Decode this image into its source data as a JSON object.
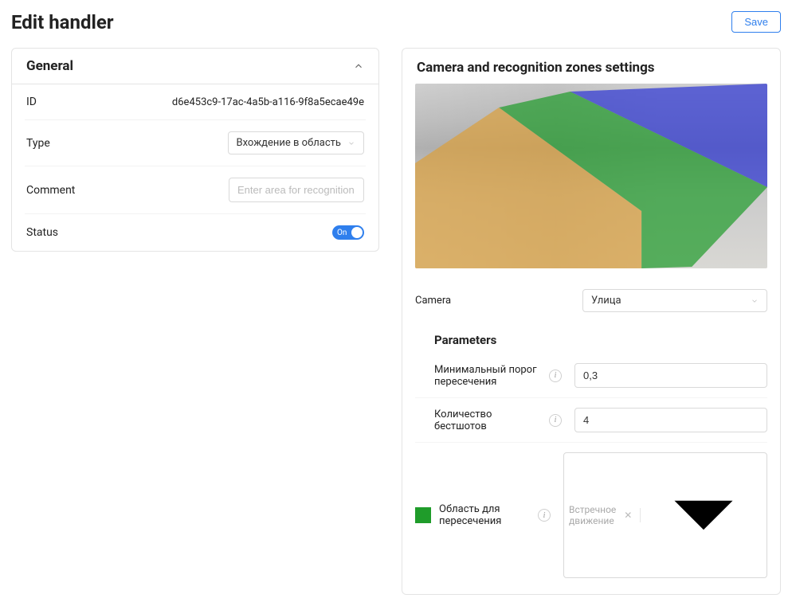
{
  "page_title": "Edit handler",
  "save_label": "Save",
  "general": {
    "title": "General",
    "id_label": "ID",
    "id_value": "d6e453c9-17ac-4a5b-a116-9f8a5ecae49e",
    "type_label": "Type",
    "type_value": "Вхождение в область",
    "comment_label": "Comment",
    "comment_placeholder": "Enter area for recognition",
    "status_label": "Status",
    "status_on": "On"
  },
  "right_panel": {
    "title": "Camera and recognition zones settings",
    "camera_label": "Camera",
    "camera_value": "Улица",
    "parameters_title": "Parameters",
    "zones": [
      {
        "name": "orange",
        "color": "#dca03c"
      },
      {
        "name": "green",
        "color": "#1f9c2a"
      },
      {
        "name": "blue",
        "color": "#2d36d5"
      }
    ],
    "params": {
      "min_threshold_label": "Минимальный порог пересечения",
      "min_threshold_value": "0,3",
      "bestshots_label": "Количество бестшотов",
      "bestshots_value": "4",
      "area_label": "Область для пересечения",
      "area_value": "Встречное движение",
      "area_swatch_color": "#1f9c2a"
    }
  }
}
